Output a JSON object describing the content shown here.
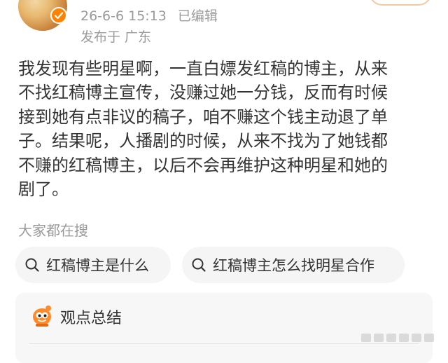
{
  "post": {
    "timestamp": "26-6-6 15:13",
    "edited_label": "已编辑",
    "location": "发布于 广东",
    "lines": [
      "我发现有些明星啊，一直白嫖发红稿的博主，从来",
      "不找红稿博主宣传，没赚过她一分钱，反而有时候",
      "接到她有点非议的稿子，咱不赚这个钱主动退了单",
      "子。结果呢，人播剧的时候，从来不找为了她钱都",
      "不赚的红稿博主，以后不会再维护这种明星和她的",
      "剧了。"
    ]
  },
  "everyone_searching": {
    "heading": "大家都在搜",
    "chips": [
      {
        "label": "红稿博主是什么",
        "icon": "search-icon"
      },
      {
        "label": "红稿博主怎么找明星合作",
        "icon": "search-icon"
      }
    ]
  },
  "summary": {
    "title": "观点总结",
    "icon": "ai-mascot-icon"
  },
  "icons": {
    "avatar": "avatar-image",
    "verified": "verified-badge-icon",
    "watermark": "platform-watermark"
  },
  "colors": {
    "text_primary": "#333333",
    "text_secondary": "#9a9a9a",
    "verified_badge": "#ff8200",
    "chip_background": "#f5f5f5",
    "summary_mascot": "#ff8a2a"
  }
}
